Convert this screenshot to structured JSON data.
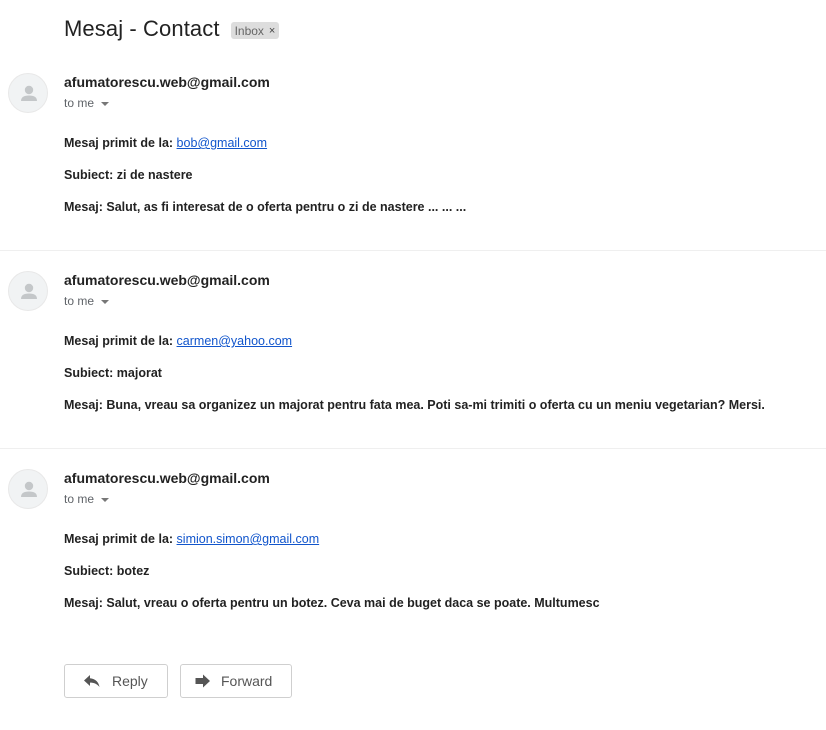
{
  "subject": "Mesaj - Contact",
  "label": {
    "name": "Inbox",
    "remove": "×"
  },
  "messages": [
    {
      "sender": "afumatorescu.web@gmail.com",
      "to": "to me",
      "from_label": "Mesaj primit de la:",
      "from_email": "bob@gmail.com",
      "subject_line": "Subiect: zi de nastere",
      "message_line": "Mesaj: Salut, as fi interesat de o oferta pentru o zi de nastere ... ... ..."
    },
    {
      "sender": "afumatorescu.web@gmail.com",
      "to": "to me",
      "from_label": "Mesaj primit de la:",
      "from_email": "carmen@yahoo.com",
      "subject_line": "Subiect: majorat",
      "message_line": "Mesaj: Buna, vreau sa organizez un majorat pentru fata mea. Poti sa-mi trimiti o oferta cu un meniu vegetarian? Mersi."
    },
    {
      "sender": "afumatorescu.web@gmail.com",
      "to": "to me",
      "from_label": "Mesaj primit de la:",
      "from_email": "simion.simon@gmail.com",
      "subject_line": "Subiect: botez",
      "message_line": "Mesaj: Salut, vreau o oferta pentru un botez. Ceva mai de buget daca se poate. Multumesc"
    }
  ],
  "actions": {
    "reply": "Reply",
    "forward": "Forward"
  },
  "icons": {
    "avatar": "person-icon",
    "to_dropdown": "caret-down-icon",
    "reply": "reply-arrow-icon",
    "forward": "forward-arrow-icon"
  }
}
